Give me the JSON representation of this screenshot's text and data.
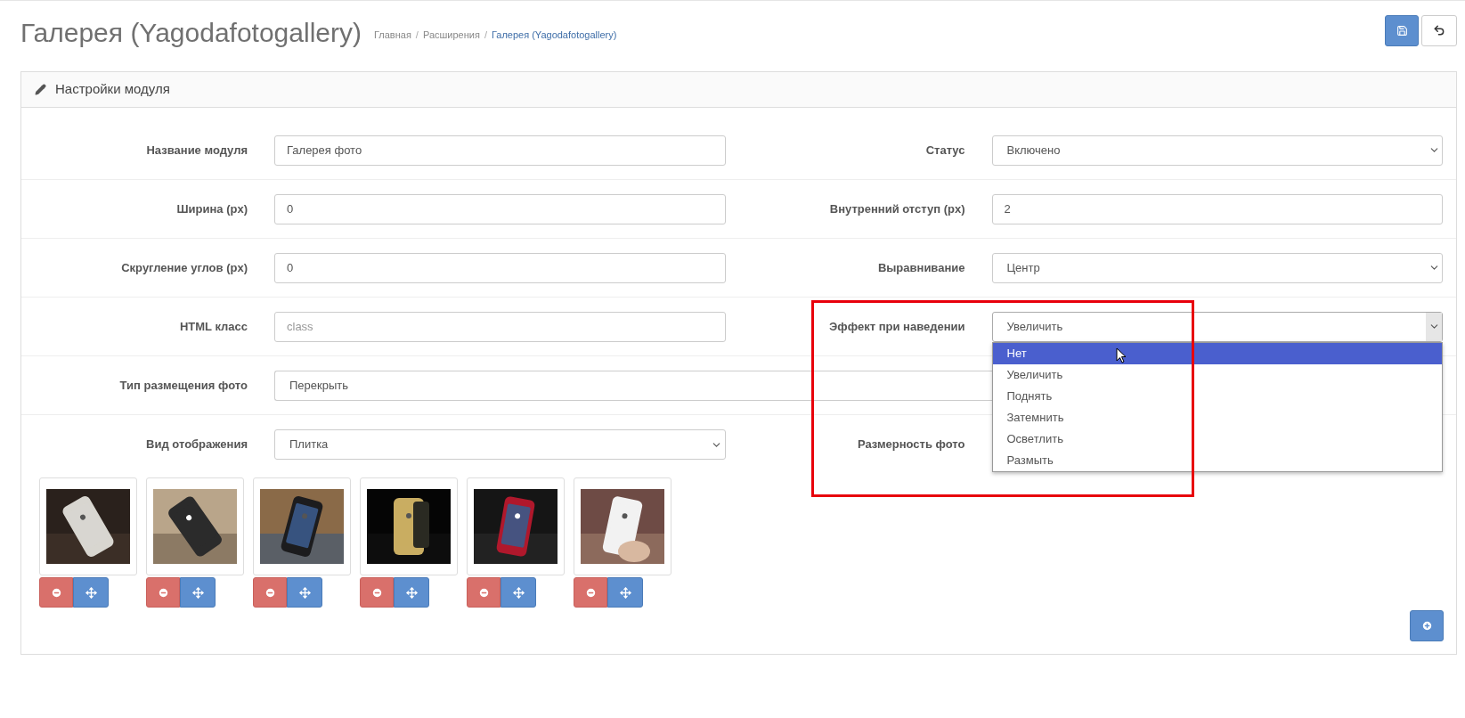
{
  "page": {
    "title": "Галерея (Yagodafotogallery)"
  },
  "breadcrumbs": [
    {
      "label": "Главная",
      "active": false
    },
    {
      "label": "Расширения",
      "separator": "/",
      "active": false
    },
    {
      "label": "Галерея (Yagodafotogallery)",
      "separator": "/",
      "active": true
    }
  ],
  "panel": {
    "title": "Настройки модуля"
  },
  "rows": [
    {
      "left": {
        "label": "Название модуля",
        "kind": "input",
        "value": "Галерея фото"
      },
      "right": {
        "label": "Статус",
        "kind": "select",
        "value": "Включено"
      }
    },
    {
      "left": {
        "label": "Ширина (px)",
        "kind": "input",
        "value": "0"
      },
      "right": {
        "label": "Внутренний отступ (px)",
        "kind": "input",
        "value": "2"
      }
    },
    {
      "left": {
        "label": "Скругление углов (px)",
        "kind": "input",
        "value": "0"
      },
      "right": {
        "label": "Выравнивание",
        "kind": "select",
        "value": "Центр"
      }
    },
    {
      "left": {
        "label": "HTML класс",
        "kind": "input",
        "placeholder": "class"
      },
      "right": {
        "label": "Эффект при наведении",
        "kind": "select",
        "value": "Увеличить",
        "open": true
      }
    },
    {
      "left": {
        "label": "Тип размещения фото",
        "kind": "wide",
        "value": "Перекрыть"
      }
    },
    {
      "left": {
        "label": "Вид отображения",
        "kind": "select",
        "value": "Плитка"
      },
      "right": {
        "label": "Размерность фото",
        "kind": "hidden"
      }
    }
  ],
  "dropdown": {
    "options": [
      {
        "label": "Нет",
        "highlighted": true
      },
      {
        "label": "Увеличить",
        "highlighted": false
      },
      {
        "label": "Поднять",
        "highlighted": false
      },
      {
        "label": "Затемнить",
        "highlighted": false
      },
      {
        "label": "Осветлить",
        "highlighted": false
      },
      {
        "label": "Размыть",
        "highlighted": false
      }
    ]
  }
}
